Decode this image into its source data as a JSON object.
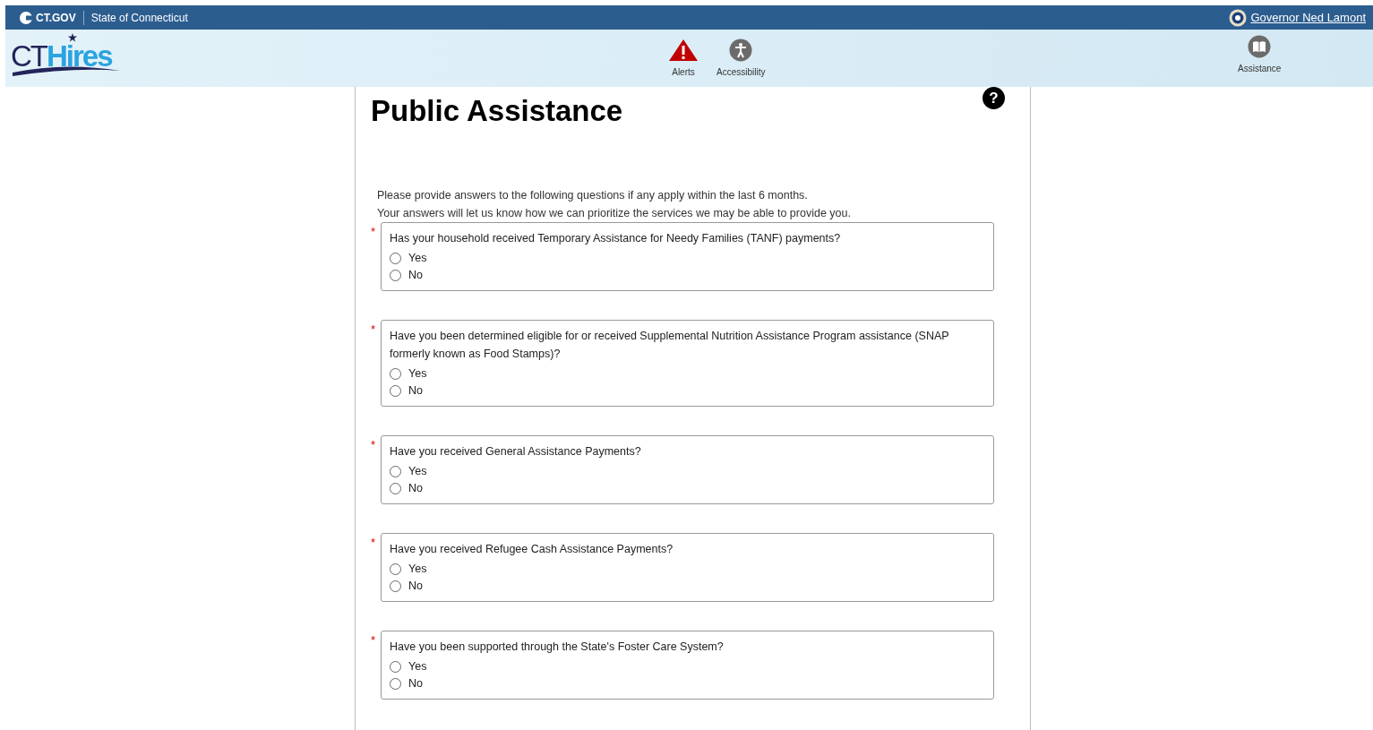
{
  "top_bar": {
    "brand": "CT.GOV",
    "state": "State of Connecticut",
    "governor_link": "Governor Ned Lamont"
  },
  "header": {
    "logo": {
      "part_1": "CT",
      "part_2": "Hires"
    },
    "nav": [
      {
        "label": "Alerts",
        "kind": "alert"
      },
      {
        "label": "Accessibility",
        "kind": "accessibility"
      }
    ],
    "right_nav": [
      {
        "label": "Assistance",
        "kind": "book"
      }
    ]
  },
  "page": {
    "title": "Public Assistance",
    "help": "?",
    "intro": [
      "Please provide answers to the following questions if any apply within the last 6 months.",
      "Your answers will let us know how we can prioritize the services we may be able to provide you."
    ],
    "required_marker": "*",
    "questions": [
      {
        "required": true,
        "text": "Has your household received Temporary Assistance for Needy Families (TANF) payments?",
        "options": [
          {
            "label": "Yes",
            "selected": false
          },
          {
            "label": "No",
            "selected": false
          }
        ]
      },
      {
        "required": true,
        "text": "Have you been determined eligible for or received Supplemental Nutrition Assistance Program assistance (SNAP formerly known as Food Stamps)?",
        "options": [
          {
            "label": "Yes",
            "selected": false
          },
          {
            "label": "No",
            "selected": false
          }
        ]
      },
      {
        "required": true,
        "text": "Have you received General Assistance Payments?",
        "options": [
          {
            "label": "Yes",
            "selected": false
          },
          {
            "label": "No",
            "selected": false
          }
        ]
      },
      {
        "required": true,
        "text": "Have you received Refugee Cash Assistance Payments?",
        "options": [
          {
            "label": "Yes",
            "selected": false
          },
          {
            "label": "No",
            "selected": false
          }
        ]
      },
      {
        "required": true,
        "text": "Have you been supported through the State's Foster Care System?",
        "options": [
          {
            "label": "Yes",
            "selected": false
          },
          {
            "label": "No",
            "selected": false
          }
        ]
      }
    ]
  }
}
